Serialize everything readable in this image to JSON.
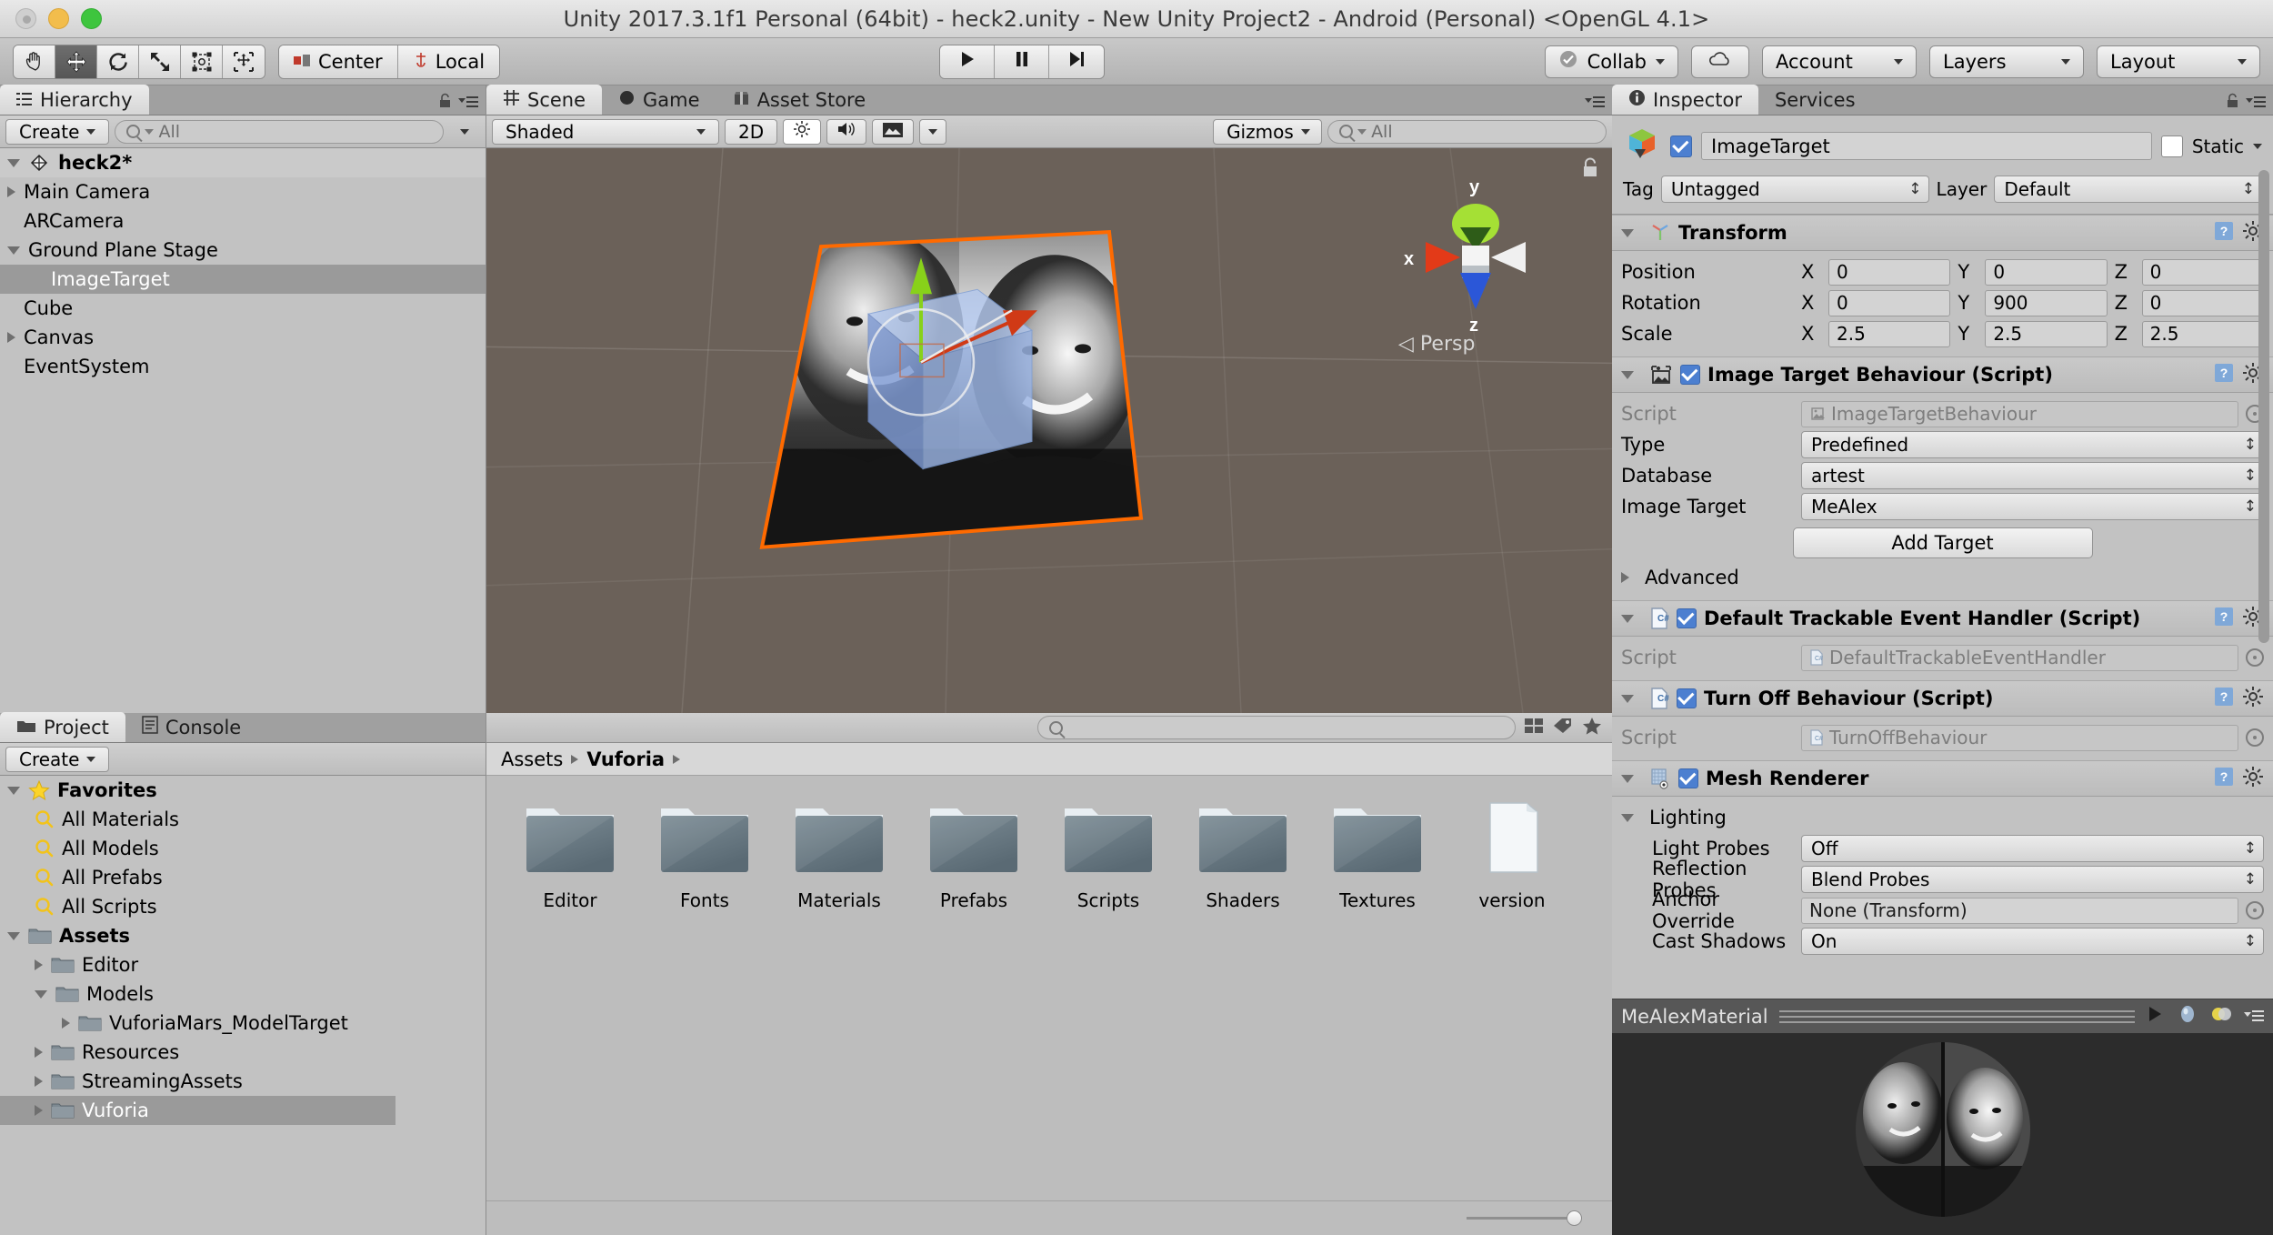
{
  "window": {
    "title": "Unity 2017.3.1f1 Personal (64bit) - heck2.unity - New Unity Project2 - Android (Personal) <OpenGL 4.1>"
  },
  "toolbar": {
    "tools": [
      {
        "name": "hand-tool",
        "icon": "hand-icon",
        "active": false
      },
      {
        "name": "move-tool",
        "icon": "move-icon",
        "active": true
      },
      {
        "name": "rotate-tool",
        "icon": "rotate-icon",
        "active": false
      },
      {
        "name": "scale-tool",
        "icon": "scale-icon",
        "active": false
      },
      {
        "name": "rect-tool",
        "icon": "rect-transform-icon",
        "active": false
      },
      {
        "name": "transform-tool",
        "icon": "combined-transform-icon",
        "active": false
      }
    ],
    "pivot_label": "Center",
    "space_label": "Local",
    "play_label": "play-icon",
    "pause_label": "pause-icon",
    "step_label": "step-icon",
    "collab_label": "Collab",
    "cloud_label": "cloud-icon",
    "account_label": "Account",
    "layers_label": "Layers",
    "layout_label": "Layout"
  },
  "hierarchy": {
    "tab_label": "Hierarchy",
    "create_label": "Create",
    "search_placeholder": "All",
    "scene_name": "heck2*",
    "items": [
      {
        "label": "Main Camera",
        "depth": 1,
        "expandable": true,
        "expanded": false,
        "selected": false
      },
      {
        "label": "ARCamera",
        "depth": 1,
        "expandable": false,
        "expanded": false,
        "selected": false
      },
      {
        "label": "Ground Plane Stage",
        "depth": 1,
        "expandable": true,
        "expanded": true,
        "selected": false
      },
      {
        "label": "ImageTarget",
        "depth": 2,
        "expandable": false,
        "expanded": false,
        "selected": true
      },
      {
        "label": "Cube",
        "depth": 1,
        "expandable": false,
        "expanded": false,
        "selected": false
      },
      {
        "label": "Canvas",
        "depth": 1,
        "expandable": true,
        "expanded": false,
        "selected": false
      },
      {
        "label": "EventSystem",
        "depth": 1,
        "expandable": false,
        "expanded": false,
        "selected": false
      }
    ]
  },
  "scene": {
    "tabs": [
      {
        "label": "Scene",
        "icon": "grid-icon",
        "active": true
      },
      {
        "label": "Game",
        "icon": "gamepad-icon",
        "active": false
      },
      {
        "label": "Asset Store",
        "icon": "store-icon",
        "active": false
      }
    ],
    "draw_mode": "Shaded",
    "mode_2d": "2D",
    "lighting_icon": "sun-icon",
    "audio_icon": "speaker-icon",
    "fx_icon": "image-effects-icon",
    "gizmos_label": "Gizmos",
    "search_placeholder": "All",
    "axis_x": "x",
    "axis_y": "y",
    "axis_z": "z",
    "perspective_label": "Persp"
  },
  "project": {
    "tabs": [
      {
        "label": "Project",
        "icon": "folder-icon",
        "active": true
      },
      {
        "label": "Console",
        "icon": "console-icon",
        "active": false
      }
    ],
    "create_label": "Create",
    "search_placeholder": "",
    "favorites_label": "Favorites",
    "favorites": [
      "All Materials",
      "All Models",
      "All Prefabs",
      "All Scripts"
    ],
    "assets_label": "Assets",
    "tree": [
      {
        "label": "Editor",
        "depth": 1,
        "expandable": true,
        "expanded": false,
        "selected": false
      },
      {
        "label": "Models",
        "depth": 1,
        "expandable": true,
        "expanded": true,
        "selected": false
      },
      {
        "label": "VuforiaMars_ModelTarget",
        "depth": 2,
        "expandable": true,
        "expanded": false,
        "selected": false
      },
      {
        "label": "Resources",
        "depth": 1,
        "expandable": true,
        "expanded": false,
        "selected": false
      },
      {
        "label": "StreamingAssets",
        "depth": 1,
        "expandable": true,
        "expanded": false,
        "selected": false
      },
      {
        "label": "Vuforia",
        "depth": 1,
        "expandable": true,
        "expanded": false,
        "selected": true
      }
    ],
    "breadcrumbs": [
      "Assets",
      "Vuforia"
    ],
    "assets": [
      {
        "label": "Editor",
        "type": "folder"
      },
      {
        "label": "Fonts",
        "type": "folder"
      },
      {
        "label": "Materials",
        "type": "folder"
      },
      {
        "label": "Prefabs",
        "type": "folder"
      },
      {
        "label": "Scripts",
        "type": "folder"
      },
      {
        "label": "Shaders",
        "type": "folder"
      },
      {
        "label": "Textures",
        "type": "folder"
      },
      {
        "label": "version",
        "type": "file"
      }
    ]
  },
  "inspector": {
    "tabs": [
      {
        "label": "Inspector",
        "icon": "info-icon",
        "active": true
      },
      {
        "label": "Services",
        "icon": "",
        "active": false
      }
    ],
    "object_name": "ImageTarget",
    "object_enabled": true,
    "static_label": "Static",
    "static_checked": false,
    "tag_label": "Tag",
    "tag_value": "Untagged",
    "layer_label": "Layer",
    "layer_value": "Default",
    "transform": {
      "title": "Transform",
      "rows": [
        {
          "label": "Position",
          "x": "0",
          "y": "0",
          "z": "0"
        },
        {
          "label": "Rotation",
          "x": "0",
          "y": "900",
          "z": "0"
        },
        {
          "label": "Scale",
          "x": "2.5",
          "y": "2.5",
          "z": "2.5"
        }
      ]
    },
    "image_target": {
      "title": "Image Target Behaviour (Script)",
      "enabled": true,
      "script_label": "Script",
      "script_value": "ImageTargetBehaviour",
      "type_label": "Type",
      "type_value": "Predefined",
      "database_label": "Database",
      "database_value": "artest",
      "image_target_label": "Image Target",
      "image_target_value": "MeAlex",
      "add_target_label": "Add Target",
      "advanced_label": "Advanced"
    },
    "trackable_handler": {
      "title": "Default Trackable Event Handler (Script)",
      "enabled": true,
      "script_label": "Script",
      "script_value": "DefaultTrackableEventHandler"
    },
    "turn_off": {
      "title": "Turn Off Behaviour (Script)",
      "enabled": true,
      "script_label": "Script",
      "script_value": "TurnOffBehaviour"
    },
    "mesh_renderer": {
      "title": "Mesh Renderer",
      "enabled": true,
      "lighting_label": "Lighting",
      "rows": [
        {
          "label": "Light Probes",
          "value": "Off",
          "kind": "dropdown"
        },
        {
          "label": "Reflection Probes",
          "value": "Blend Probes",
          "kind": "dropdown"
        },
        {
          "label": "Anchor Override",
          "value": "None (Transform)",
          "kind": "object"
        },
        {
          "label": "Cast Shadows",
          "value": "On",
          "kind": "dropdown"
        }
      ]
    },
    "material_preview": {
      "name": "MeAlexMaterial",
      "play_icon": "play-icon",
      "lighting_icon": "sphere-icon",
      "material_icon": "material-icon",
      "menu_icon": "menu-icon"
    }
  },
  "colors": {
    "panel_bg": "#c2c2c2",
    "toolbar_bg": "#bdbdbd",
    "scene_bg": "#6b6159",
    "selection": "#9a9a9a",
    "accent_blue": "#4c7fd0",
    "selection_orange": "#ff6a00",
    "axis_x": "#e03a1e",
    "axis_y": "#a0e030",
    "axis_z": "#2d5de0"
  }
}
